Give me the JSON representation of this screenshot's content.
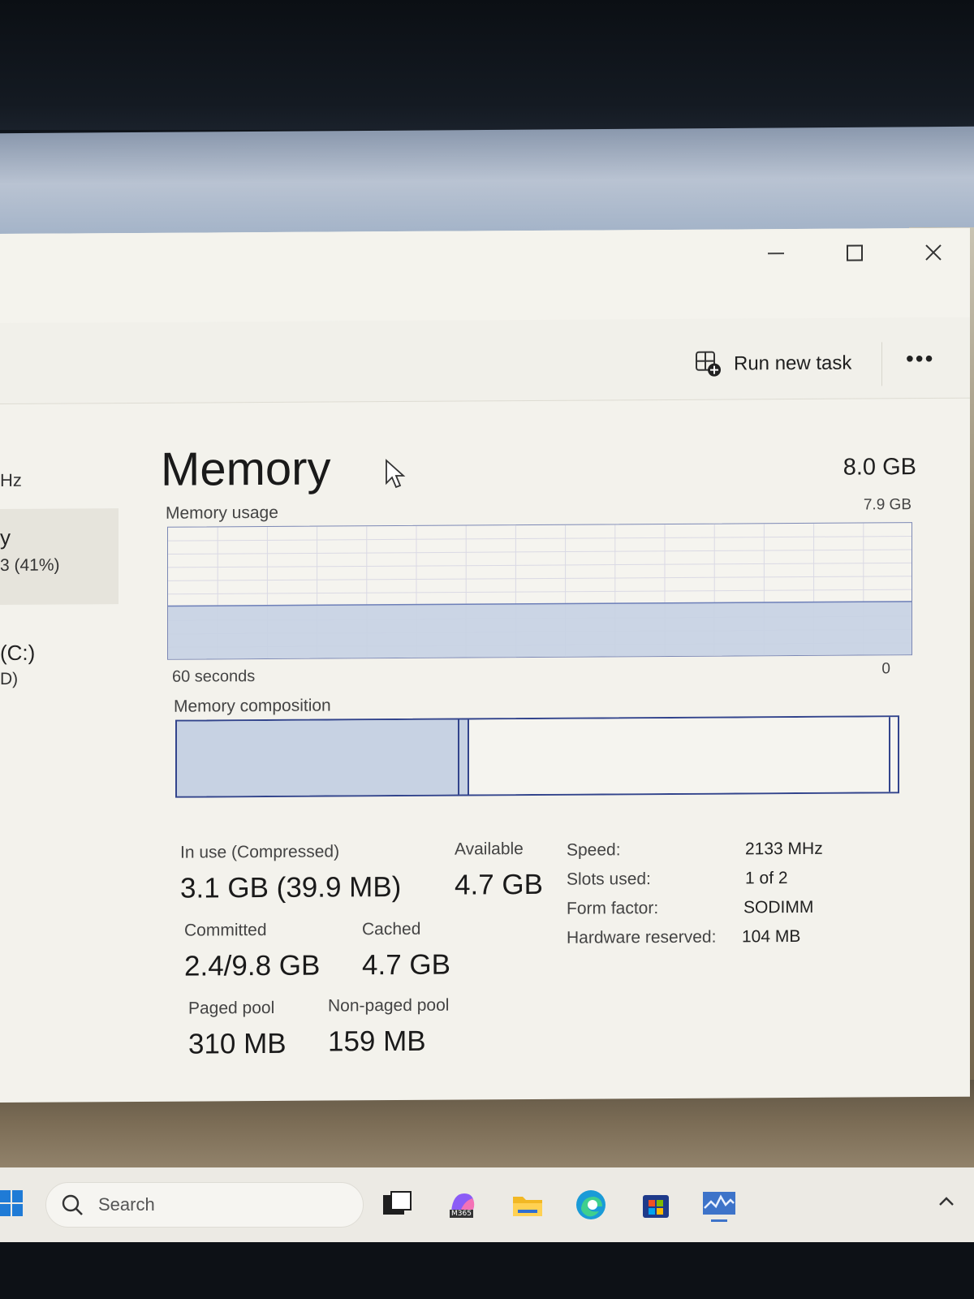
{
  "window": {
    "toolbar": {
      "run_new_task_label": "Run new task",
      "more_label": "•••"
    }
  },
  "sidebar": {
    "cpu_sub": "Hz",
    "memory_title": "y",
    "memory_sub": "3 (41%)",
    "disk_title": "(C:)",
    "disk_sub": "D)"
  },
  "memory": {
    "title": "Memory",
    "total": "8.0 GB",
    "usage_label": "Memory usage",
    "usage_max": "7.9 GB",
    "axis_left": "60 seconds",
    "axis_right": "0",
    "usage_fraction": 0.41,
    "composition_label": "Memory composition",
    "composition": {
      "in_use_gb": 3.1,
      "modified_gb": 0.1,
      "standby_gb": 4.6,
      "free_gb": 0.1,
      "total_gb": 7.9
    },
    "stats": {
      "in_use_label": "In use (Compressed)",
      "in_use_value": "3.1 GB (39.9 MB)",
      "available_label": "Available",
      "available_value": "4.7 GB",
      "committed_label": "Committed",
      "committed_value": "2.4/9.8 GB",
      "cached_label": "Cached",
      "cached_value": "4.7 GB",
      "paged_pool_label": "Paged pool",
      "paged_pool_value": "310 MB",
      "nonpaged_pool_label": "Non-paged pool",
      "nonpaged_pool_value": "159 MB"
    },
    "specs": {
      "speed_label": "Speed:",
      "speed_value": "2133 MHz",
      "slots_label": "Slots used:",
      "slots_value": "1 of 2",
      "form_label": "Form factor:",
      "form_value": "SODIMM",
      "hw_label": "Hardware reserved:",
      "hw_value": "104 MB"
    }
  },
  "taskbar": {
    "search_label": "Search",
    "copilot_badge": "M365"
  },
  "colors": {
    "accent": "#32448c",
    "graph_fill": "#c7d2e3",
    "grid": "#dad9e4"
  }
}
